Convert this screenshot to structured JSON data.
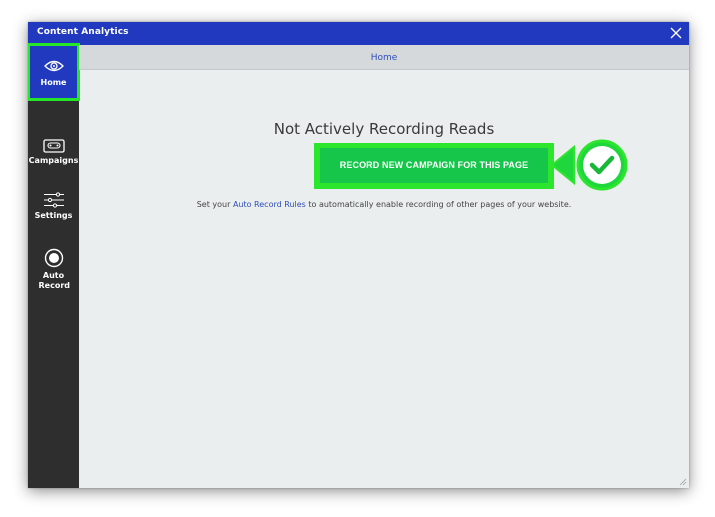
{
  "window": {
    "title": "Content Analytics"
  },
  "sidebar": {
    "items": [
      {
        "label": "Home",
        "icon": "eye-icon",
        "active": true
      },
      {
        "label": "Campaigns",
        "icon": "cassette-icon",
        "active": false
      },
      {
        "label": "Settings",
        "icon": "sliders-icon",
        "active": false
      },
      {
        "label": "Auto Record",
        "icon": "record-icon",
        "active": false
      }
    ]
  },
  "main": {
    "breadcrumb": "Home",
    "status_heading": "Not Actively Recording Reads",
    "record_button": "RECORD NEW CAMPAIGN FOR THIS PAGE",
    "hint": {
      "prefix": "Set your ",
      "link": "Auto Record Rules",
      "suffix": " to automatically enable recording of other pages of your website."
    }
  },
  "colors": {
    "titlebar": "#2039bf",
    "sidebar": "#2e2e2e",
    "highlight": "#26e62a",
    "button": "#15c64a",
    "link": "#2e4fb8",
    "content_bg": "#eaeeef"
  }
}
